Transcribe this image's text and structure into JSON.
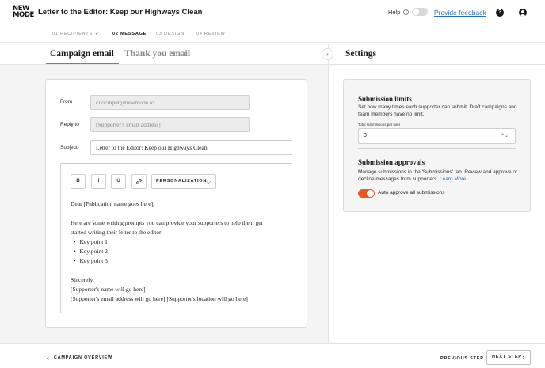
{
  "header": {
    "logo_line1": "NEW",
    "logo_line2": "MODE",
    "title": "Letter to the Editor: Keep our Highways Clean",
    "help_label": "Help",
    "feedback_label": "Provide feedback"
  },
  "steps": [
    {
      "label": "01 Recipients",
      "done": true
    },
    {
      "label": "02 Message",
      "active": true
    },
    {
      "label": "03 Design"
    },
    {
      "label": "04 Review"
    }
  ],
  "tabs": {
    "campaign": "Campaign email",
    "thankyou": "Thank you email"
  },
  "form": {
    "from_label": "From",
    "from_value": "civicinput@newmode.io",
    "reply_label": "Reply to",
    "reply_value": "[Supporter's email address]",
    "subject_label": "Subject",
    "subject_value": "Letter to the Editor: Keep our Highways Clean"
  },
  "toolbar": {
    "bold": "B",
    "italic": "I",
    "underline": "U",
    "personalization": "Personalization"
  },
  "email_body": {
    "greeting": "Dear [Publication name goes here],",
    "intro_line1": "Here are some writing prompts you can provide your supporters to help them get",
    "intro_line2": "started writing their letter to the editor",
    "points": [
      "Key point 1",
      "Key point 2",
      "Key point 3"
    ],
    "closing": "Sincerely,",
    "sig_name": "[Supporter's name will go here]",
    "sig_details": "[Supporter's email address will go here] [Supporter's location will go here]"
  },
  "settings": {
    "title": "Settings",
    "limits_title": "Submission limits",
    "limits_desc": "Set how many times each supporter can submit. Draft campaigns and team members have no limit.",
    "limits_field_label": "Total submissions per user",
    "limits_value": "3",
    "approvals_title": "Submission approvals",
    "approvals_desc": "Manage submissions in the 'Submissions' tab. Review and approve or decline messages from supporters.",
    "learn_more": "Learn More",
    "auto_approve_label": "Auto approve all submissions",
    "auto_approve_on": true
  },
  "footer": {
    "back_label": "Campaign overview",
    "prev_label": "Previous step",
    "next_label": "Next step"
  },
  "colors": {
    "accent": "#e85a24",
    "link": "#2a6fb5",
    "check": "#2e9b43"
  }
}
